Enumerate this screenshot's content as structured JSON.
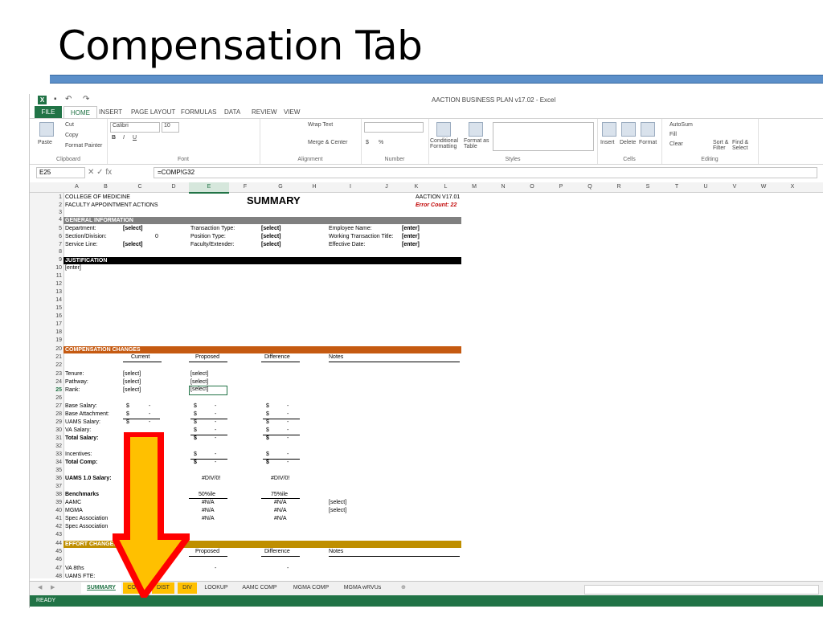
{
  "slide_title": "Compensation Tab",
  "window_title": "AACTION BUSINESS PLAN v17.02 - Excel",
  "ribbon_tabs": [
    "FILE",
    "HOME",
    "INSERT",
    "PAGE LAYOUT",
    "FORMULAS",
    "DATA",
    "REVIEW",
    "VIEW"
  ],
  "ribbon": {
    "clipboard": {
      "paste": "Paste",
      "cut": "Cut",
      "copy": "Copy",
      "format_painter": "Format Painter",
      "label": "Clipboard"
    },
    "font": {
      "name": "Calibri",
      "size": "10",
      "label": "Font"
    },
    "alignment": {
      "wrap": "Wrap Text",
      "merge": "Merge & Center",
      "label": "Alignment"
    },
    "number": {
      "label": "Number",
      "currency": "$",
      "percent": "%"
    },
    "styles": {
      "cond": "Conditional Formatting",
      "table": "Format as Table",
      "label": "Styles"
    },
    "cells": {
      "insert": "Insert",
      "delete": "Delete",
      "format": "Format",
      "label": "Cells"
    },
    "editing": {
      "autosum": "AutoSum",
      "fill": "Fill",
      "clear": "Clear",
      "sort": "Sort & Filter",
      "find": "Find & Select",
      "label": "Editing"
    }
  },
  "name_box": "E25",
  "formula": "=COMP!G32",
  "columns": [
    "A",
    "B",
    "C",
    "D",
    "E",
    "F",
    "G",
    "H",
    "I",
    "J",
    "K",
    "L",
    "M",
    "N",
    "O",
    "P",
    "Q",
    "R",
    "S",
    "T",
    "U",
    "V",
    "W",
    "X"
  ],
  "sheet": {
    "college": "COLLEGE OF MEDICINE",
    "faculty": "FACULTY APPOINTMENT ACTIONS",
    "summary": "SUMMARY",
    "version": "AACTION V17.01",
    "error": "Error Count: 22",
    "general": "GENERAL INFORMATION",
    "department": "Department:",
    "department_v": "[select]",
    "section": "Section/Division:",
    "section_v": "0",
    "service": "Service Line:",
    "service_v": "[select]",
    "transaction": "Transaction Type:",
    "transaction_v": "[select]",
    "position": "Position Type:",
    "position_v": "[select]",
    "faculty_ext": "Faculty/Extender:",
    "faculty_ext_v": "[select]",
    "employee": "Employee Name:",
    "employee_v": "[enter]",
    "working": "Working Transaction Title:",
    "working_v": "[enter]",
    "effective": "Effective Date:",
    "effective_v": "[enter]",
    "justification": "JUSTIFICATION",
    "justification_v": "[enter]",
    "comp_changes": "COMPENSATION CHANGES",
    "h_current": "Current",
    "h_proposed": "Proposed",
    "h_difference": "Difference",
    "h_notes": "Notes",
    "tenure": "Tenure:",
    "pathway": "Pathway:",
    "rank": "Rank:",
    "sel": "[select]",
    "base_salary": "Base Salary:",
    "base_attach": "Base Attachment:",
    "uams_salary": "UAMS Salary:",
    "va_salary": "VA Salary:",
    "total_salary": "Total Salary:",
    "incentives": "Incentives:",
    "total_comp": "Total Comp:",
    "uams10": "UAMS 1.0 Salary:",
    "div0": "#DIV/0!",
    "benchmarks": "Benchmarks",
    "p50": "50%ile",
    "p75": "75%ile",
    "aamc": "AAMC",
    "mgma": "MGMA",
    "spec1": "Spec Association",
    "spec2": "Spec Association",
    "na": "#N/A",
    "effort": "EFFORT CHANGES",
    "va8": "VA 8ths",
    "uams_fte": "UAMS FTE:",
    "dollar": "$",
    "dash": "-"
  },
  "sheet_tabs": [
    "SUMMARY",
    "COMP",
    "DIST",
    "DIV",
    "LOOKUP",
    "AAMC COMP",
    "MGMA COMP",
    "MGMA wRVUs"
  ],
  "status": "READY",
  "colors": {
    "excel_green": "#217346",
    "gray_band": "#808080",
    "black_band": "#000000",
    "orange_band": "#c55a11",
    "gold_band": "#bf8f00",
    "arrow_red": "#ff0000",
    "arrow_gold": "#ffc000"
  }
}
